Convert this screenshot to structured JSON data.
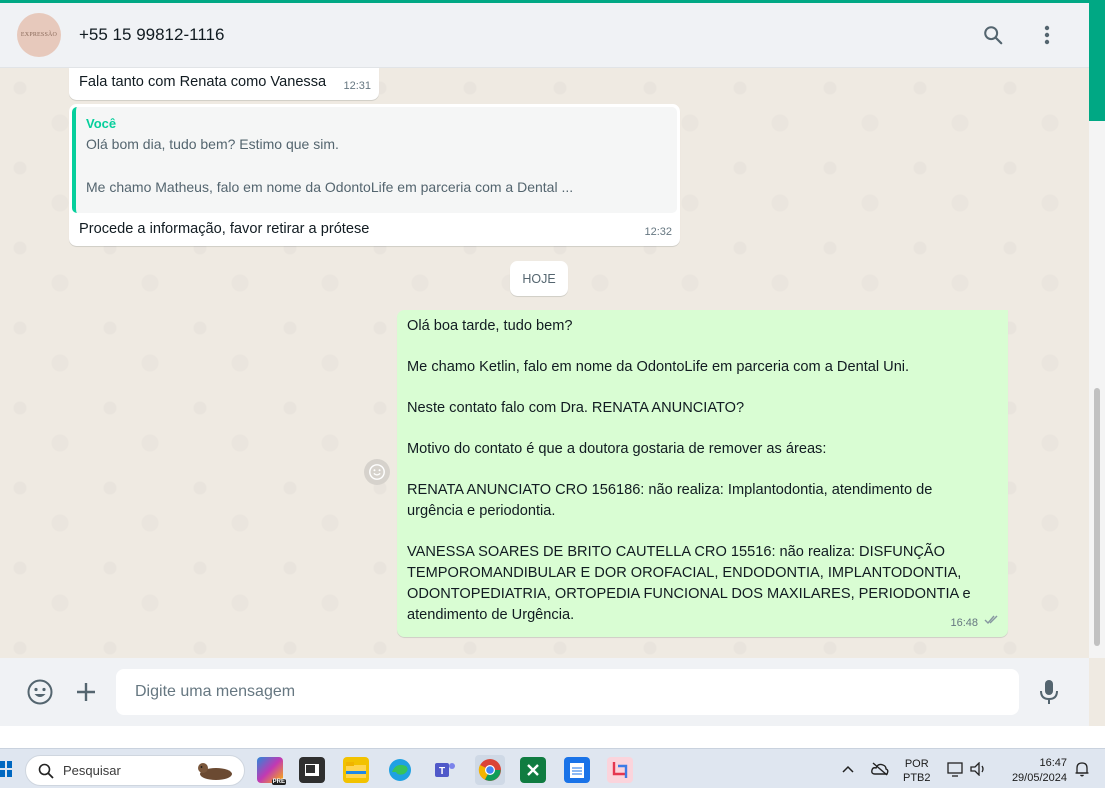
{
  "header": {
    "avatar_text": "EXPRESSÃO",
    "contact": "+55 15 99812-1116",
    "search_icon": "search-icon",
    "menu_icon": "vertical-dots-icon"
  },
  "messages": {
    "m1": {
      "text": "Fala tanto com Renata como Vanessa",
      "time": "12:31"
    },
    "m2": {
      "quote_author": "Você",
      "quote_line1": "Olá bom dia, tudo bem? Estimo que sim.",
      "quote_line2": "Me chamo Matheus, falo em nome da OdontoLife em parceria com a Dental ...",
      "text": "Procede a informação, favor retirar a prótese",
      "time": "12:32"
    },
    "date_divider": "HOJE",
    "m3": {
      "p1": "Olá boa tarde, tudo bem?",
      "p2": "Me chamo Ketlin, falo em nome da OdontoLife em parceria com a Dental Uni.",
      "p3": "Neste contato falo com Dra. RENATA ANUNCIATO?",
      "p4": "Motivo do contato é que a doutora gostaria de remover as áreas:",
      "p5a": "RENATA ANUNCIATO CRO 156186:  não realiza: Implantodontia, atendimento de",
      "p5b": "urgência e periodontia.",
      "p6a": "VANESSA SOARES DE BRITO CAUTELLA CRO 15516: não realiza:  DISFUNÇÃO",
      "p6b": "TEMPOROMANDIBULAR E DOR OROFACIAL, ENDODONTIA, IMPLANTODONTIA,",
      "p6c": "ODONTOPEDIATRIA, ORTOPEDIA FUNCIONAL DOS MAXILARES, PERIODONTIA e",
      "p6d": "atendimento de Urgência.",
      "time": "16:48"
    }
  },
  "composer": {
    "placeholder": "Digite uma mensagem",
    "emoji_icon": "emoji-icon",
    "attach_icon": "plus-icon",
    "mic_icon": "microphone-icon"
  },
  "taskbar": {
    "search_label": "Pesquisar",
    "lang_line1": "POR",
    "lang_line2": "PTB2",
    "time": "16:47",
    "date": "29/05/2024",
    "pre_badge": "PRE"
  },
  "colors": {
    "accent": "#00a884",
    "outgoing_bubble": "#d9fdd3",
    "chat_bg": "#efeae2",
    "quote_bar": "#06cf9c"
  }
}
